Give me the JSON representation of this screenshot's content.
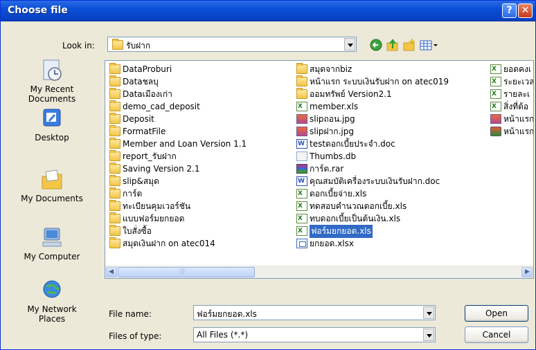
{
  "window": {
    "title": "Choose file",
    "help": "?",
    "close": "✕"
  },
  "look_in": {
    "label": "Look in:",
    "value": "รับฝาก"
  },
  "toolbar": {
    "back": "back-icon",
    "up": "up-folder-icon",
    "new_folder": "new-folder-icon",
    "views": "views-menu-icon"
  },
  "places": [
    {
      "label": "My Recent\nDocuments",
      "icon": "recent-documents-icon"
    },
    {
      "label": "Desktop",
      "icon": "desktop-icon"
    },
    {
      "label": "My Documents",
      "icon": "my-documents-icon"
    },
    {
      "label": "My Computer",
      "icon": "my-computer-icon"
    },
    {
      "label": "My Network\nPlaces",
      "icon": "network-places-icon"
    }
  ],
  "files": {
    "col1": [
      {
        "name": "DataProburi",
        "type": "folder"
      },
      {
        "name": "Dataชลบุ",
        "type": "folder"
      },
      {
        "name": "Dataเมืองเก่า",
        "type": "folder"
      },
      {
        "name": "demo_cad_deposit",
        "type": "folder"
      },
      {
        "name": "Deposit",
        "type": "folder"
      },
      {
        "name": "FormatFile",
        "type": "folder"
      },
      {
        "name": "Member and Loan Version 1.1",
        "type": "folder"
      },
      {
        "name": "report_รับฝาก",
        "type": "folder"
      },
      {
        "name": "Saving Version 2.1",
        "type": "folder"
      },
      {
        "name": "slip&สมุด",
        "type": "folder"
      },
      {
        "name": "การ์ด",
        "type": "folder"
      },
      {
        "name": "ทะเบียนคุมเวอร์ชัน",
        "type": "folder"
      },
      {
        "name": "แบบฟอร์มยกยอด",
        "type": "folder"
      },
      {
        "name": "ใบสั่งซื้อ",
        "type": "folder"
      },
      {
        "name": "สมุดเงินฝาก on atec014",
        "type": "folder"
      }
    ],
    "col2": [
      {
        "name": "สมุดจากbiz",
        "type": "folder"
      },
      {
        "name": "หน้าแรก ระบบเงินรับฝาก on atec019",
        "type": "folder"
      },
      {
        "name": "ออมทรัพย์ Version2.1",
        "type": "folder"
      },
      {
        "name": "member.xls",
        "type": "xls"
      },
      {
        "name": "slipถอน.jpg",
        "type": "jpg"
      },
      {
        "name": "slipฝาก.jpg",
        "type": "jpg"
      },
      {
        "name": "testดอกเบี้ยประจำ.doc",
        "type": "doc"
      },
      {
        "name": "Thumbs.db",
        "type": "db"
      },
      {
        "name": "การ์ด.rar",
        "type": "rar"
      },
      {
        "name": "คุณสมบัติเครื่องระบบเงินรับฝาก.doc",
        "type": "doc"
      },
      {
        "name": "ดอกเบี้ยจ่าย.xls",
        "type": "xls"
      },
      {
        "name": "ทดสอบคำนวณดอกเบี้ย.xls",
        "type": "xls"
      },
      {
        "name": "ทบดอกเบี้ยเป็นต้นเงิน.xls",
        "type": "xls"
      },
      {
        "name": "ฟอร์มยกยอด.xls",
        "type": "xls",
        "selected": true
      },
      {
        "name": "ยกยอด.xlsx",
        "type": "xlsx"
      }
    ],
    "col3": [
      {
        "name": "ยอดคงเ",
        "type": "xls"
      },
      {
        "name": "ระยะเวล",
        "type": "xls"
      },
      {
        "name": "รายละเ",
        "type": "xls"
      },
      {
        "name": "สิ่งที่ต้อ",
        "type": "xls"
      },
      {
        "name": "หน้าแรก",
        "type": "jpg"
      },
      {
        "name": "หน้าแรก",
        "type": "lnk"
      }
    ]
  },
  "scrollbar": {
    "left": "◀",
    "right": "▶"
  },
  "file_name": {
    "label": "File name:",
    "value": "ฟอร์มยกยอด.xls"
  },
  "file_type": {
    "label": "Files of type:",
    "value": "All Files (*.*)"
  },
  "buttons": {
    "open": "Open",
    "cancel": "Cancel"
  }
}
